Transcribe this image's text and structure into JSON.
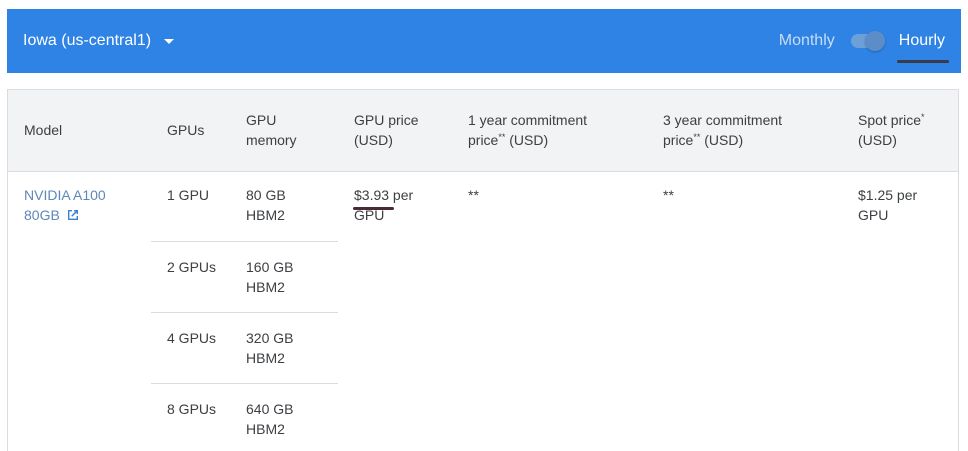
{
  "header": {
    "region": "Iowa (us-central1)",
    "monthly_label": "Monthly",
    "hourly_label": "Hourly"
  },
  "table": {
    "columns": [
      "Model",
      "GPUs",
      "GPU memory",
      "GPU price (USD)",
      "1 year commitment price",
      "3 year commitment price",
      "Spot price"
    ],
    "col_parts": {
      "gpu_memory": [
        "GPU",
        "memory"
      ],
      "gpu_price": [
        "GPU price",
        "(USD)"
      ],
      "one_year": [
        "1 year commitment",
        "price",
        "**",
        " (USD)"
      ],
      "three_year": [
        "3 year commitment",
        "price",
        "**",
        " (USD)"
      ],
      "spot": [
        "Spot price",
        "*",
        "(USD)"
      ]
    },
    "model": {
      "line1": "NVIDIA A100",
      "line2": "80GB"
    },
    "rows": [
      {
        "gpus": "1 GPU",
        "mem1": "80 GB",
        "mem2": "HBM2"
      },
      {
        "gpus": "2 GPUs",
        "mem1": "160 GB",
        "mem2": "HBM2"
      },
      {
        "gpus": "4 GPUs",
        "mem1": "320 GB",
        "mem2": "HBM2"
      },
      {
        "gpus": "8 GPUs",
        "mem1": "640 GB",
        "mem2": "HBM2"
      }
    ],
    "gpu_price": {
      "line1": "$3.93 per",
      "line2": "GPU"
    },
    "one_year_price": "**",
    "three_year_price": "**",
    "spot_price": {
      "line1": "$1.25 per",
      "line2": "GPU"
    }
  }
}
